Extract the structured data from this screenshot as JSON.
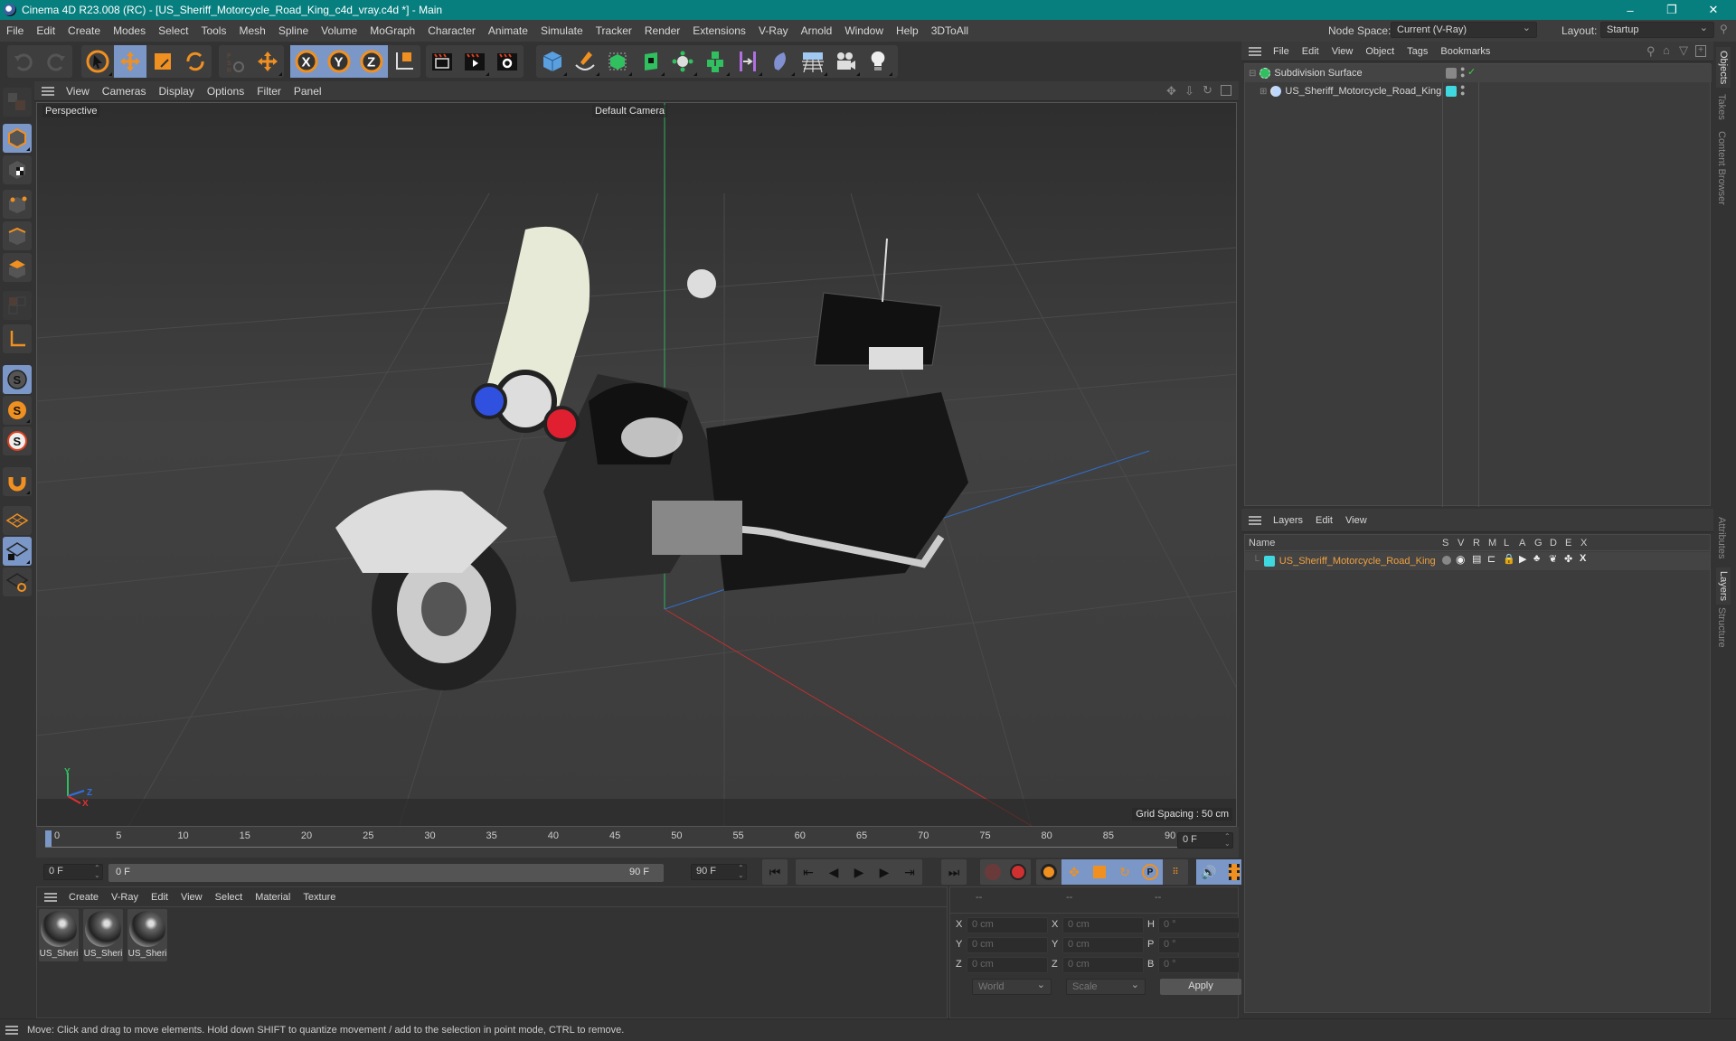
{
  "window": {
    "title": "Cinema 4D R23.008 (RC) - [US_Sheriff_Motorcycle_Road_King_c4d_vray.c4d *] - Main",
    "minimize": "–",
    "maximize": "❐",
    "close": "✕"
  },
  "menubar": {
    "items": [
      "File",
      "Edit",
      "Create",
      "Modes",
      "Select",
      "Tools",
      "Mesh",
      "Spline",
      "Volume",
      "MoGraph",
      "Character",
      "Animate",
      "Simulate",
      "Tracker",
      "Render",
      "Extensions",
      "V-Ray",
      "Arnold",
      "Window",
      "Help",
      "3DToAll"
    ],
    "node_space_label": "Node Space:",
    "node_space_value": "Current (V-Ray)",
    "layout_label": "Layout:",
    "layout_value": "Startup"
  },
  "toolbar": {
    "groups": [
      [
        "undo-icon",
        "redo-icon"
      ],
      [
        "live-selection-icon",
        "move-icon",
        "scale-icon",
        "rotate-icon"
      ],
      [
        "psr-icon",
        "move-axis-icon"
      ],
      [
        "x-axis-lock-icon",
        "y-axis-lock-icon",
        "z-axis-lock-icon",
        "coordinate-system-icon"
      ],
      [
        "render-view-icon",
        "render-to-picture-viewer-icon",
        "render-settings-icon"
      ],
      [
        "cube-icon",
        "pen-icon",
        "subdivision-icon",
        "extrude-icon",
        "cloner-icon",
        "mograph-icon",
        "symmetry-icon",
        "deformer-icon",
        "floor-icon",
        "camera-icon",
        "light-icon"
      ]
    ]
  },
  "left_tools": [
    "make-editable-icon",
    "model-mode-icon",
    "texture-mode-icon",
    "point-mode-icon",
    "edge-mode-icon",
    "polygon-mode-icon",
    "uv-mode-icon",
    "axis-icon",
    "solo-icon",
    "solo-hierarchy-icon",
    "solo-off-icon",
    "snap-icon",
    "workplane-icon",
    "locked-workplane-icon",
    "workplane-align-icon"
  ],
  "viewport": {
    "menu": [
      "View",
      "Cameras",
      "Display",
      "Options",
      "Filter",
      "Panel"
    ],
    "view_name": "Perspective",
    "camera": "Default Camera",
    "grid_spacing": "Grid Spacing : 50 cm",
    "axis_labels": {
      "x": "X",
      "y": "Y",
      "z": "Z"
    }
  },
  "timeline": {
    "ticks": [
      "0",
      "5",
      "10",
      "15",
      "20",
      "25",
      "30",
      "35",
      "40",
      "45",
      "50",
      "55",
      "60",
      "65",
      "70",
      "75",
      "80",
      "85",
      "90"
    ],
    "current_frame": "0 F",
    "start_field": "0 F",
    "range_start": "0 F",
    "range_end": "90 F",
    "end_field": "90 F"
  },
  "material_manager": {
    "menu": [
      "Create",
      "V-Ray",
      "Edit",
      "View",
      "Select",
      "Material",
      "Texture"
    ],
    "materials": [
      "US_Sheri",
      "US_Sheri",
      "US_Sheri"
    ]
  },
  "coordinates": {
    "headers": [
      "--",
      "--",
      "--"
    ],
    "rows": [
      {
        "l1": "X",
        "v1": "0 cm",
        "l2": "X",
        "v2": "0 cm",
        "l3": "H",
        "v3": "0 °"
      },
      {
        "l1": "Y",
        "v1": "0 cm",
        "l2": "Y",
        "v2": "0 cm",
        "l3": "P",
        "v3": "0 °"
      },
      {
        "l1": "Z",
        "v1": "0 cm",
        "l2": "Z",
        "v2": "0 cm",
        "l3": "B",
        "v3": "0 °"
      }
    ],
    "space": "World",
    "mode": "Scale",
    "apply": "Apply"
  },
  "object_manager": {
    "menu": [
      "File",
      "Edit",
      "View",
      "Object",
      "Tags",
      "Bookmarks"
    ],
    "objects": [
      {
        "name": "Subdivision Surface",
        "color": "#8a8a8a"
      },
      {
        "name": "US_Sheriff_Motorcycle_Road_King",
        "color": "#3fd8e0"
      }
    ]
  },
  "layer_manager": {
    "menu": [
      "Layers",
      "Edit",
      "View"
    ],
    "columns": [
      "Name",
      "S",
      "V",
      "R",
      "M",
      "L",
      "A",
      "G",
      "D",
      "E",
      "X"
    ],
    "layers": [
      {
        "name": "US_Sheriff_Motorcycle_Road_King",
        "color": "#3fd8e0",
        "text_color": "#f0a040"
      }
    ]
  },
  "side_tabs_top": [
    "Objects",
    "Takes",
    "Content Browser"
  ],
  "side_tabs_bottom": [
    "Attributes",
    "Layers",
    "Structure"
  ],
  "status": "Move: Click and drag to move elements. Hold down SHIFT to quantize movement / add to the selection in point mode, CTRL to remove."
}
